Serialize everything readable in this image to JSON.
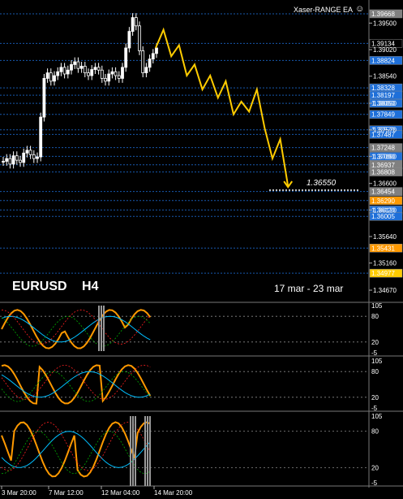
{
  "header": {
    "ea_name": "Xaser-RANGE EA",
    "ea_icon": "smiley-icon"
  },
  "main": {
    "symbol": "EURUSD",
    "timeframe": "H4",
    "period": "17 mar - 23 mar",
    "target_label": "1.36550"
  },
  "price_axis": {
    "plain_ticks": [
      "1.39500",
      "1.39020",
      "1.38540",
      "1.38050",
      "1.37570",
      "1.37090",
      "1.36600",
      "1.36120",
      "1.35640",
      "1.35160",
      "1.34670"
    ],
    "levels": [
      {
        "price": "1.39668",
        "color": "#808080"
      },
      {
        "price": "1.39134",
        "color": "#000000"
      },
      {
        "price": "1.38824",
        "color": "#1e6fd9"
      },
      {
        "price": "1.38328",
        "color": "#1e6fd9"
      },
      {
        "price": "1.38197",
        "color": "#1e6fd9"
      },
      {
        "price": "1.38050",
        "color": "#1e6fd9"
      },
      {
        "price": "1.37849",
        "color": "#1e6fd9"
      },
      {
        "price": "1.37570",
        "color": "#1e6fd9"
      },
      {
        "price": "1.37487",
        "color": "#1e6fd9"
      },
      {
        "price": "1.37248",
        "color": "#808080"
      },
      {
        "price": "1.37090",
        "color": "#1e6fd9"
      },
      {
        "price": "1.36937",
        "color": "#808080"
      },
      {
        "price": "1.36808",
        "color": "#808080"
      },
      {
        "price": "1.36454",
        "color": "#808080"
      },
      {
        "price": "1.36290",
        "color": "#ff9900"
      },
      {
        "price": "1.36120",
        "color": "#1e6fd9"
      },
      {
        "price": "1.36005",
        "color": "#1e6fd9"
      },
      {
        "price": "1.35431",
        "color": "#ff9900"
      },
      {
        "price": "1.34977",
        "color": "#ffcc00"
      }
    ]
  },
  "time_axis": [
    "3 Mar 20:00",
    "7 Mar 12:00",
    "12 Mar 04:00",
    "14 Mar 20:00"
  ],
  "oscillators": [
    {
      "top": "105",
      "upper": "80",
      "lower": "20",
      "bottom": "-5"
    },
    {
      "top": "105",
      "upper": "80",
      "lower": "20",
      "bottom": "-5"
    },
    {
      "top": "105",
      "upper": "80",
      "lower": "20",
      "bottom": "-5"
    }
  ],
  "colors": {
    "forecast": "#ffcc00",
    "level_line": "#1e6fd9",
    "candle": "#ffffff",
    "sub_orange": "#ff9900",
    "sub_cyan": "#00bfff",
    "sub_red": "#ff2020",
    "sub_green": "#00aa00"
  },
  "chart_data": [
    {
      "type": "line",
      "title": "",
      "xlabel": "",
      "ylabel": "",
      "ylim": [
        1.3445,
        1.398
      ],
      "x": [
        "3 Mar 20:00",
        "7 Mar 12:00",
        "12 Mar 04:00",
        "14 Mar 20:00"
      ],
      "series": [
        {
          "name": "",
          "points": [
            [
              0,
              1.37
            ],
            [
              1,
              1.3705
            ],
            [
              2,
              1.3695
            ],
            [
              3,
              1.371
            ],
            [
              4,
              1.3702
            ],
            [
              5,
              1.3698
            ],
            [
              6,
              1.3715
            ],
            [
              7,
              1.372
            ],
            [
              8,
              1.3712
            ],
            [
              9,
              1.3705
            ],
            [
              10,
              1.3708
            ],
            [
              11,
              1.378
            ],
            [
              12,
              1.385
            ],
            [
              13,
              1.386
            ],
            [
              14,
              1.3845
            ],
            [
              15,
              1.3855
            ],
            [
              16,
              1.3862
            ],
            [
              17,
              1.387
            ],
            [
              18,
              1.3858
            ],
            [
              19,
              1.3865
            ],
            [
              20,
              1.3875
            ],
            [
              21,
              1.388
            ],
            [
              22,
              1.3868
            ],
            [
              23,
              1.3872
            ],
            [
              24,
              1.386
            ],
            [
              25,
              1.3855
            ],
            [
              26,
              1.3866
            ],
            [
              27,
              1.387
            ],
            [
              28,
              1.3865
            ],
            [
              29,
              1.385
            ],
            [
              30,
              1.3845
            ],
            [
              31,
              1.3858
            ],
            [
              32,
              1.3862
            ],
            [
              33,
              1.3855
            ],
            [
              34,
              1.385
            ],
            [
              35,
              1.387
            ],
            [
              36,
              1.3905
            ],
            [
              37,
              1.3935
            ],
            [
              38,
              1.396
            ],
            [
              39,
              1.3945
            ],
            [
              40,
              1.39
            ],
            [
              41,
              1.386
            ],
            [
              42,
              1.387
            ],
            [
              43,
              1.3885
            ],
            [
              44,
              1.3895
            ],
            [
              45,
              1.3905
            ]
          ]
        }
      ]
    },
    {
      "type": "line",
      "title": "forecast",
      "ylim": [
        1.3445,
        1.398
      ],
      "series": [
        {
          "name": "",
          "points": [
            [
              0,
              1.3905
            ],
            [
              1,
              1.3938
            ],
            [
              2,
              1.389
            ],
            [
              3,
              1.391
            ],
            [
              4,
              1.3855
            ],
            [
              5,
              1.3875
            ],
            [
              6,
              1.383
            ],
            [
              7,
              1.3855
            ],
            [
              8,
              1.3815
            ],
            [
              9,
              1.3845
            ],
            [
              10,
              1.3785
            ],
            [
              11,
              1.3808
            ],
            [
              12,
              1.379
            ],
            [
              13,
              1.383
            ],
            [
              14,
              1.376
            ],
            [
              15,
              1.3705
            ],
            [
              16,
              1.374
            ],
            [
              17,
              1.3655
            ]
          ]
        }
      ]
    }
  ]
}
